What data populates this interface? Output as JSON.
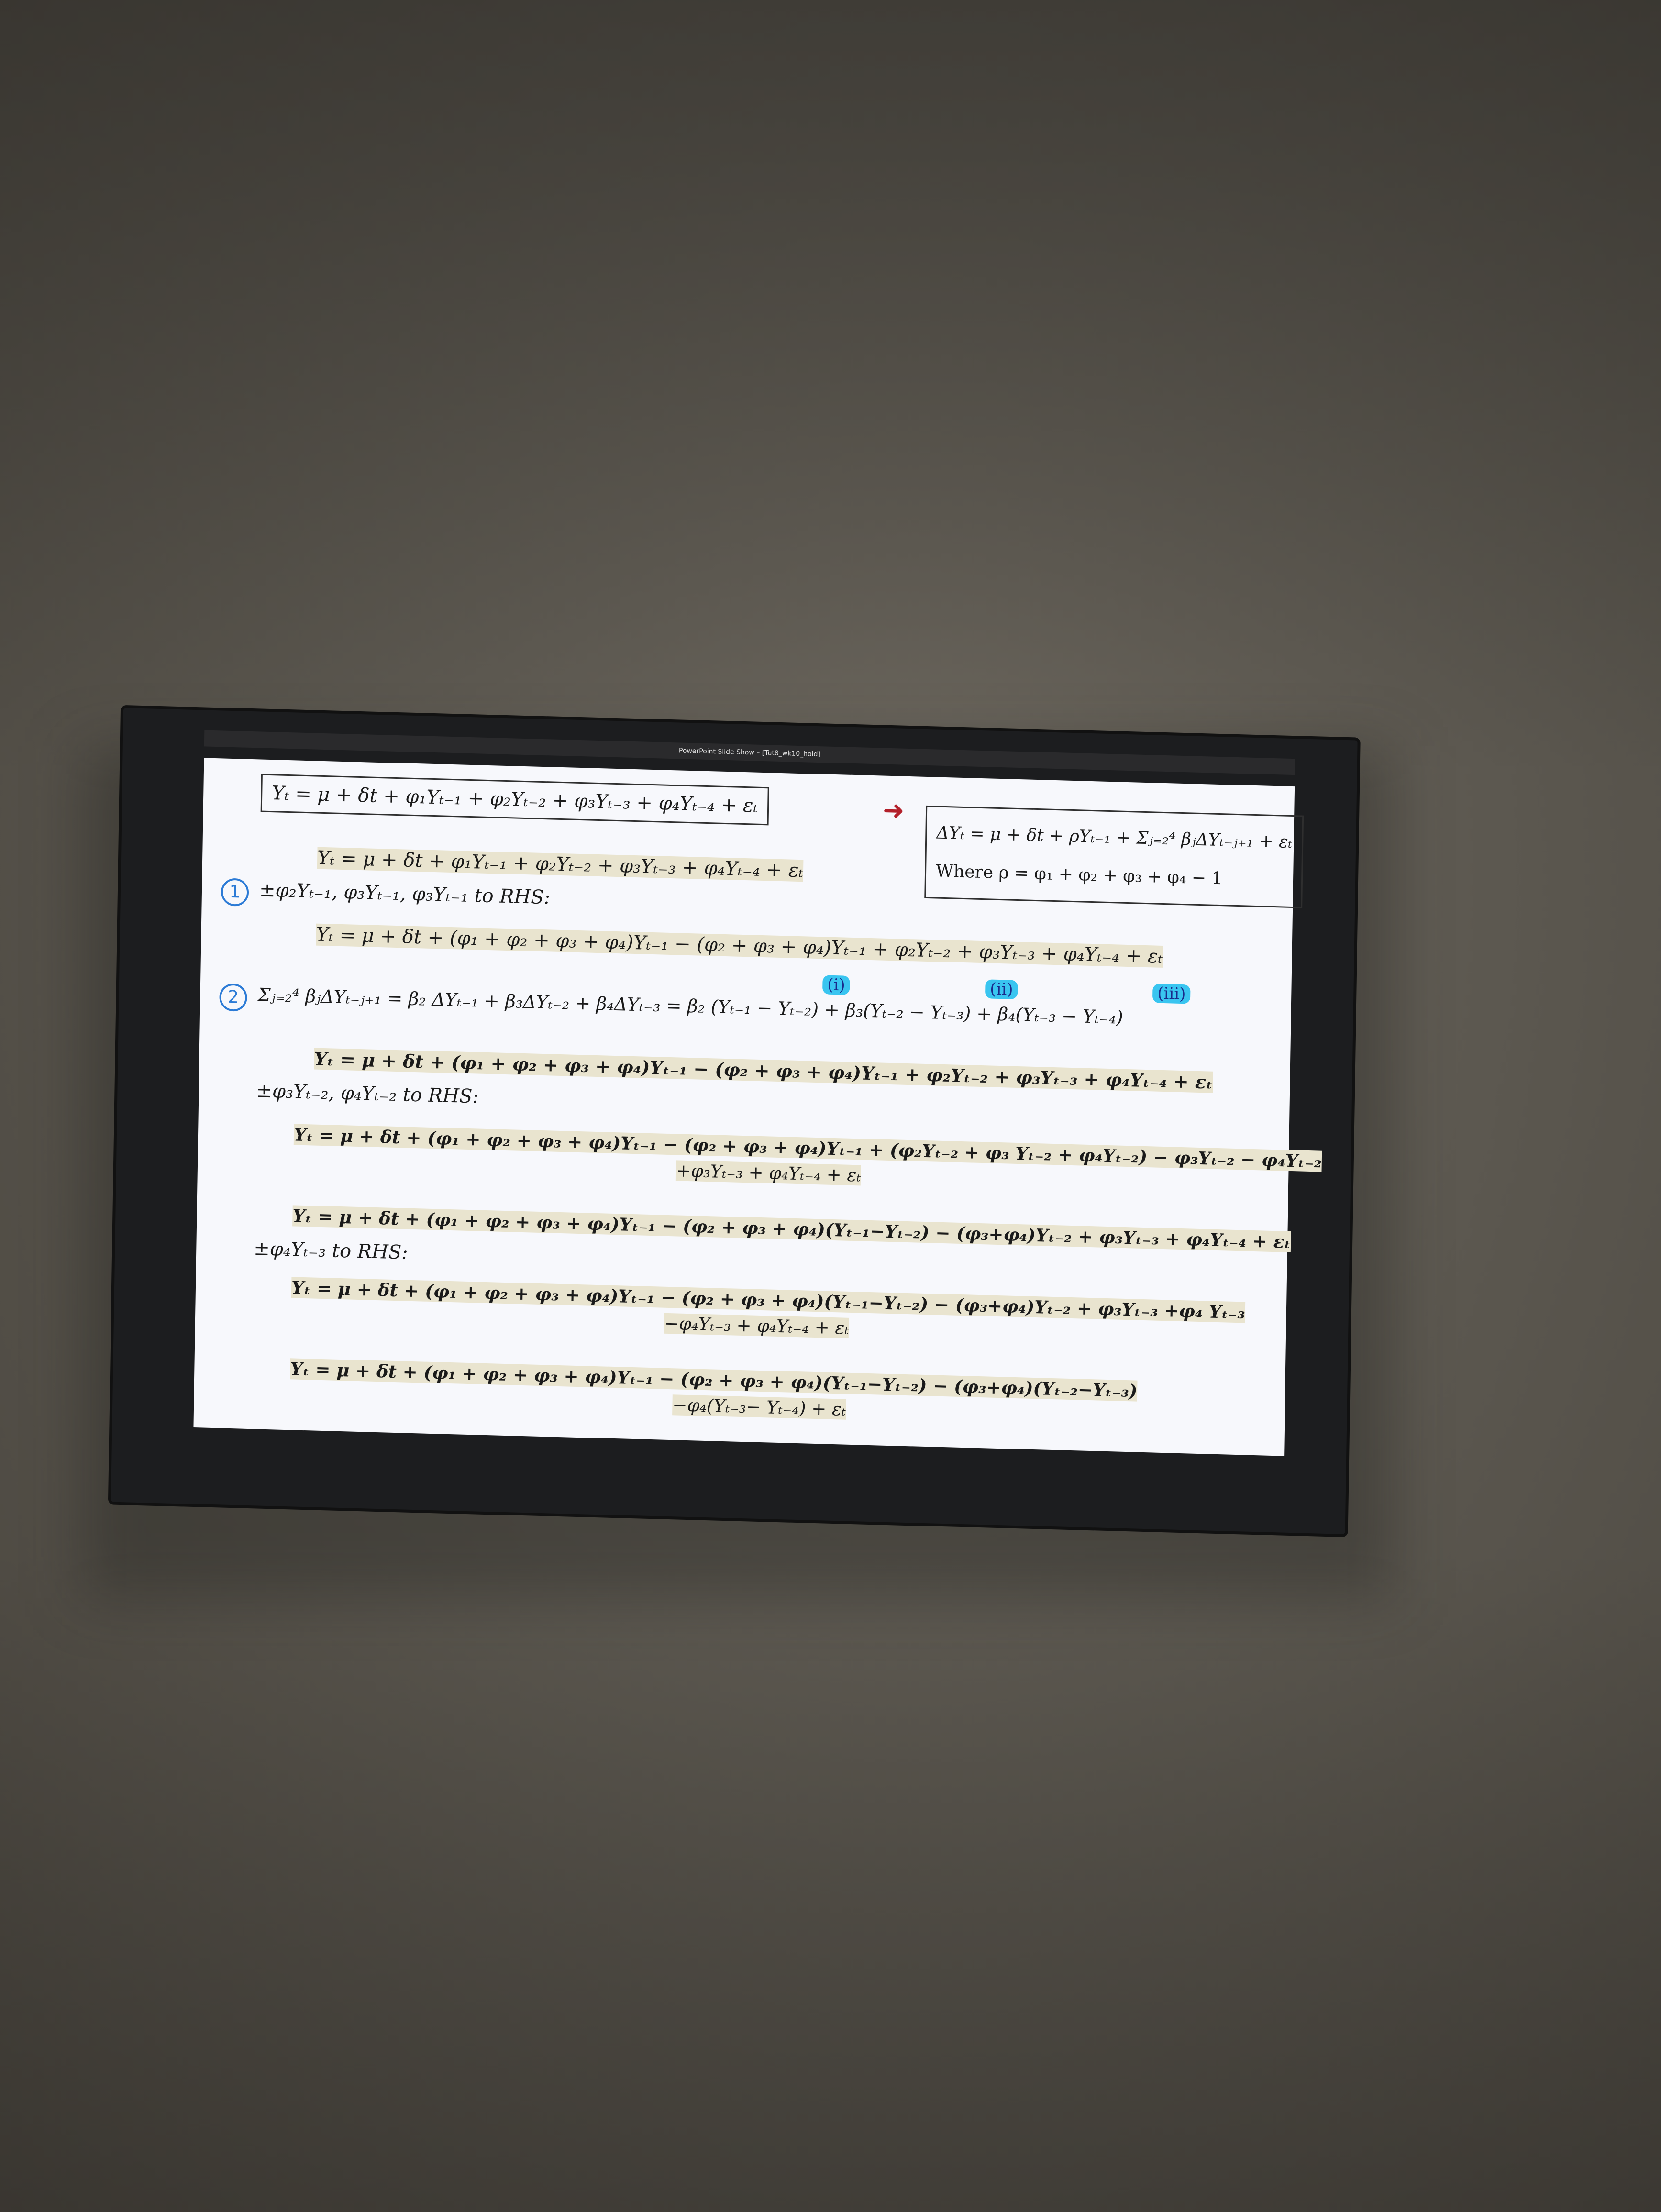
{
  "window": {
    "title": "PowerPoint Slide Show – [Tut8_wk10_hold]"
  },
  "slide": {
    "eq_top_box": "Yₜ = μ + δt + φ₁Yₜ₋₁ + φ₂Yₜ₋₂ + φ₃Yₜ₋₃ + φ₄Yₜ₋₄ + εₜ",
    "arrow": "➜",
    "eq_result_box": "ΔYₜ = μ + δt + ρYₜ₋₁ + Σⱼ₌₂⁴ βⱼΔYₜ₋ⱼ₊₁ + εₜ",
    "eq_result_where": "Where ρ = φ₁ + φ₂ + φ₃ + φ₄ − 1",
    "step1_num": "1",
    "step2_num": "2",
    "lines": [
      "Yₜ = μ + δt + φ₁Yₜ₋₁ + φ₂Yₜ₋₂ + φ₃Yₜ₋₃ + φ₄Yₜ₋₄ + εₜ",
      "±φ₂Yₜ₋₁, φ₃Yₜ₋₁, φ₃Yₜ₋₁ to RHS:",
      "Yₜ = μ + δt + (φ₁ + φ₂ + φ₃ + φ₄)Yₜ₋₁ − (φ₂ + φ₃ + φ₄)Yₜ₋₁ + φ₂Yₜ₋₂ + φ₃Yₜ₋₃ + φ₄Yₜ₋₄ + εₜ",
      "Σⱼ₌₂⁴ βⱼΔYₜ₋ⱼ₊₁ = β₂ ΔYₜ₋₁ + β₃ΔYₜ₋₂ + β₄ΔYₜ₋₃   = β₂ (Yₜ₋₁ − Yₜ₋₂) + β₃(Yₜ₋₂ − Yₜ₋₃) + β₄(Yₜ₋₃ − Yₜ₋₄)",
      "Yₜ = μ + δt + (φ₁ + φ₂ + φ₃ + φ₄)Yₜ₋₁ − (φ₂ + φ₃ + φ₄)Yₜ₋₁ + φ₂Yₜ₋₂ + φ₃Yₜ₋₃ + φ₄Yₜ₋₄ + εₜ",
      "±φ₃Yₜ₋₂, φ₄Yₜ₋₂ to RHS:",
      "Yₜ = μ + δt + (φ₁ + φ₂ + φ₃ + φ₄)Yₜ₋₁ − (φ₂ + φ₃ + φ₄)Yₜ₋₁ + (φ₂Yₜ₋₂ + φ₃ Yₜ₋₂ + φ₄Yₜ₋₂) − φ₃Yₜ₋₂ − φ₄Yₜ₋₂",
      "+φ₃Yₜ₋₃ + φ₄Yₜ₋₄ + εₜ",
      "Yₜ = μ + δt + (φ₁ + φ₂ + φ₃ + φ₄)Yₜ₋₁ − (φ₂ + φ₃ + φ₄)(Yₜ₋₁−Yₜ₋₂) − (φ₃+φ₄)Yₜ₋₂ + φ₃Yₜ₋₃ + φ₄Yₜ₋₄ + εₜ",
      "±φ₄Yₜ₋₃ to RHS:",
      "Yₜ = μ + δt + (φ₁ + φ₂ + φ₃ + φ₄)Yₜ₋₁ − (φ₂ + φ₃ + φ₄)(Yₜ₋₁−Yₜ₋₂) − (φ₃+φ₄)Yₜ₋₂ + φ₃Yₜ₋₃ +φ₄ Yₜ₋₃",
      "−φ₄Yₜ₋₃ + φ₄Yₜ₋₄ + εₜ",
      "Yₜ = μ + δt + (φ₁ + φ₂ + φ₃ + φ₄)Yₜ₋₁ − (φ₂ + φ₃ + φ₄)(Yₜ₋₁−Yₜ₋₂) − (φ₃+φ₄)(Yₜ₋₂−Yₜ₋₃)",
      "−φ₄(Yₜ₋₃− Yₜ₋₄) + εₜ"
    ],
    "tags": {
      "i": "(i)",
      "ii": "(ii)",
      "iii": "(iii)"
    }
  }
}
